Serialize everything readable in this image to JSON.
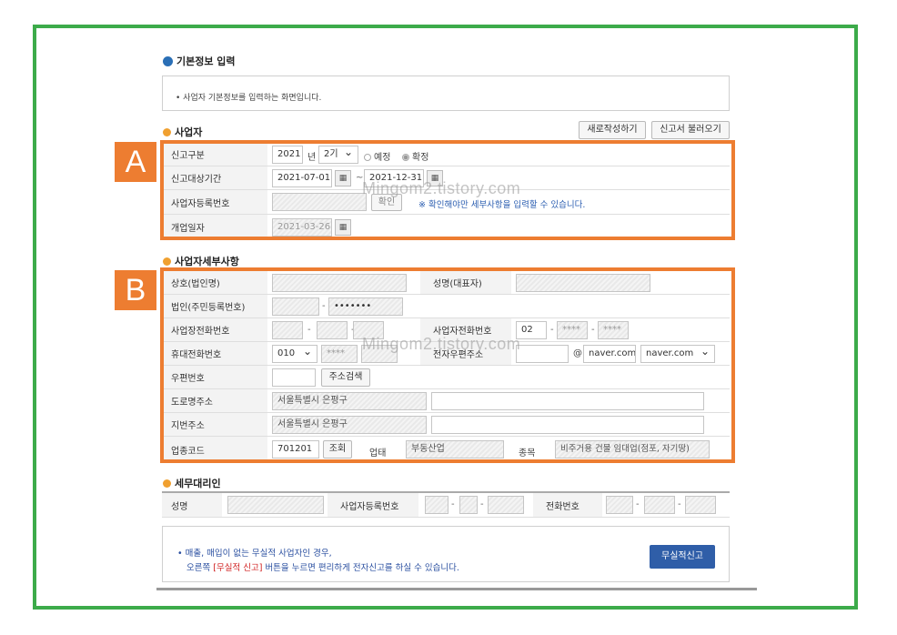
{
  "basic": {
    "title": "기본정보 입력",
    "notice": "• 사업자 기본정보를 입력하는 화면입니다."
  },
  "biz_section": {
    "title": "사업자",
    "new_button": "새로작성하기",
    "load_button": "신고서 불러오기",
    "report_type_label": "신고구분",
    "year_value": "2021",
    "year_unit": "년",
    "period_value": "2기",
    "option_preliminary": "예정",
    "option_final": "확정",
    "period_label": "신고대상기간",
    "period_from": "2021-07-01",
    "period_to": "2021-12-31",
    "period_sep": "~",
    "reg_no_label": "사업자등록번호",
    "confirm_button": "확인",
    "confirm_hint": "※ 확인해야만 세부사항을 입력할 수 있습니다.",
    "open_date_label": "개업일자",
    "open_date_value": "2021-03-26"
  },
  "detail_section": {
    "title": "사업자세부사항",
    "company_label": "상호(법인명)",
    "rep_label": "성명(대표자)",
    "corp_no_label": "법인(주민등록번호)",
    "corp_no_masked": "•••••••",
    "biz_phone_label": "사업장전화번호",
    "owner_phone_label": "사업자전화번호",
    "owner_phone_area": "02",
    "owner_phone_mid": "****",
    "owner_phone_last": "****",
    "mobile_label": "휴대전화번호",
    "mobile_prefix": "010",
    "mobile_mid": "****",
    "email_label": "전자우편주소",
    "email_at": "@",
    "email_domain": "naver.com",
    "email_domain_select": "naver.com",
    "postal_label": "우편번호",
    "address_search_button": "주소검색",
    "road_address_label": "도로명주소",
    "road_address_value": "서울특별시 은평구",
    "lot_address_label": "지번주소",
    "lot_address_value": "서울특별시 은평구",
    "industry_code_label": "업종코드",
    "industry_code_value": "701201",
    "lookup_button": "조회",
    "business_type_label": "업태",
    "business_type_value": "부동산업",
    "business_item_label": "종목",
    "business_item_value": "비주거용 건물 임대업(점포, 자기땅)"
  },
  "agent_section": {
    "title": "세무대리인",
    "name_label": "성명",
    "reg_no_label": "사업자등록번호",
    "phone_label": "전화번호"
  },
  "bottom": {
    "line1": "• 매출, 매입이 없는 무실적 사업자인 경우,",
    "line2_pre": "오른쪽",
    "line2_highlight": "[무실적 신고]",
    "line2_post": "버튼을 누르면 편리하게 전자신고를 하실 수 있습니다.",
    "submit_button": "무실적신고"
  },
  "annotations": {
    "badge_a": "A",
    "badge_b": "B",
    "watermark": "Mingom2.tistory.com"
  },
  "colors": {
    "frame": "#3cab4a",
    "highlight": "#ed7d31",
    "primary_button": "#2f5ea8"
  }
}
